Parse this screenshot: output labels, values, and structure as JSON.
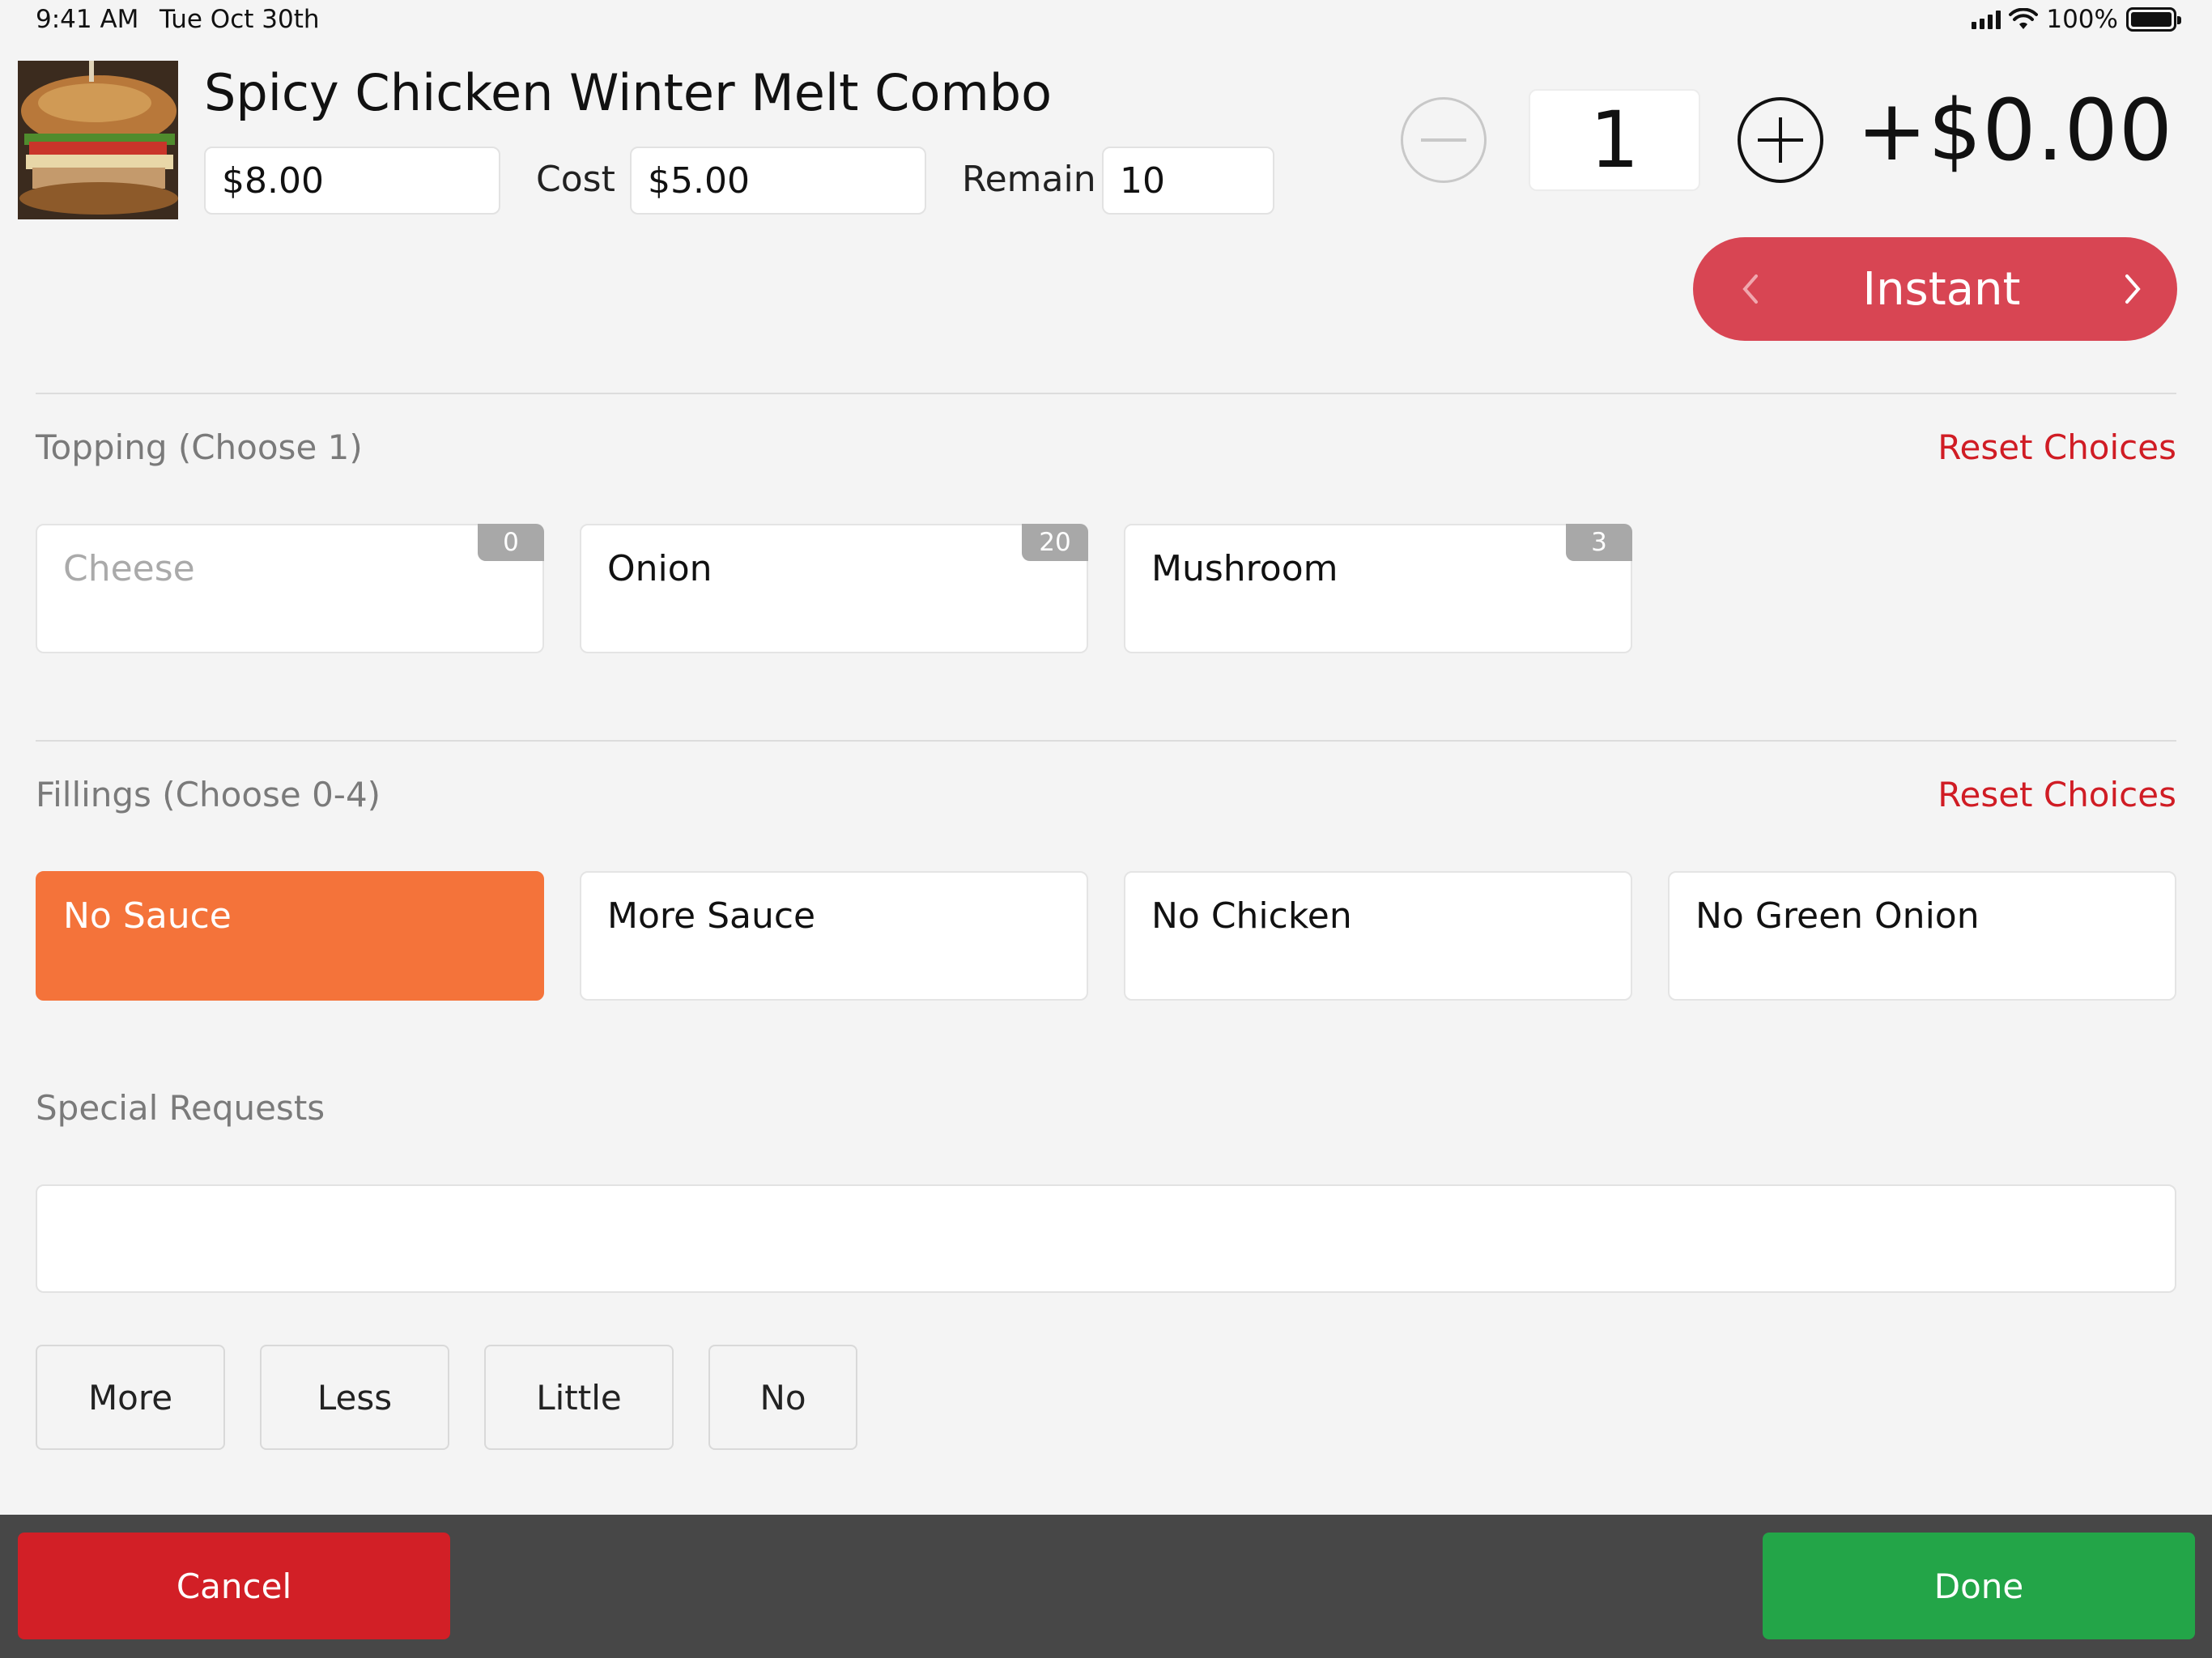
{
  "status_bar": {
    "time": "9:41 AM",
    "date": "Tue Oct 30th",
    "battery": "100%"
  },
  "item": {
    "title": "Spicy Chicken Winter Melt Combo",
    "price": "$8.00",
    "cost_label": "Cost",
    "cost": "$5.00",
    "remain_label": "Remain",
    "remain": "10",
    "quantity": "1",
    "price_delta": "+$0.00",
    "image_icon": "sandwich-photo"
  },
  "mode_selector": {
    "label": "Instant"
  },
  "topping": {
    "title": "Topping (Choose 1)",
    "reset_label": "Reset Choices",
    "options": [
      {
        "label": "Cheese",
        "count": "0",
        "state": "disabled"
      },
      {
        "label": "Onion",
        "count": "20",
        "state": "normal"
      },
      {
        "label": "Mushroom",
        "count": "3",
        "state": "normal"
      }
    ]
  },
  "fillings": {
    "title": "Fillings (Choose 0-4)",
    "reset_label": "Reset Choices",
    "options": [
      {
        "label": "No Sauce",
        "state": "selected"
      },
      {
        "label": "More Sauce",
        "state": "normal"
      },
      {
        "label": "No Chicken",
        "state": "normal"
      },
      {
        "label": "No Green Onion",
        "state": "normal"
      }
    ]
  },
  "special_requests": {
    "title": "Special Requests",
    "value": "",
    "quick_buttons": [
      "More",
      "Less",
      "Little",
      "No"
    ]
  },
  "footer": {
    "cancel_label": "Cancel",
    "done_label": "Done"
  },
  "colors": {
    "accent_red": "#d01c24",
    "instant_red": "#d84553",
    "selected_orange": "#f4733a",
    "done_green": "#23a548",
    "cancel_red": "#d21f26",
    "footer_bg": "#474747"
  }
}
